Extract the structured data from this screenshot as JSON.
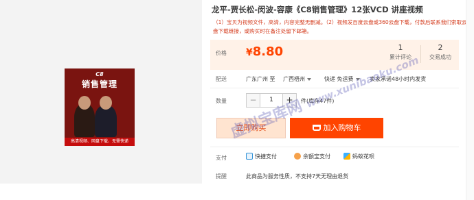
{
  "product": {
    "title": "龙平-贾长松-闵波-容康《C8销售管理》12张VCD 讲座视频",
    "subtitle": "（1）宝贝为视频文件，高清，内容完整无删减。（2）视频发百度云盘或360云盘下载，付款后联系我们索取云盘下载链接，或购买时在备注处留下邮箱。",
    "cover": {
      "logo": "C8",
      "title": "销售管理",
      "band": "高清视频、网盘下载、无需快递"
    }
  },
  "price": {
    "label": "价格",
    "currency": "¥",
    "value": "8.80"
  },
  "stats": [
    {
      "count": "1",
      "label": "累计评论"
    },
    {
      "count": "2",
      "label": "交易成功"
    }
  ],
  "shipping": {
    "label": "配送",
    "from": "广东广州 至",
    "to": "广西梧州",
    "method": "快递 免运费",
    "note": "卖家承诺48小时内发货"
  },
  "quantity": {
    "label": "数量",
    "value": "1",
    "minus": "−",
    "plus": "+",
    "unit": "件(库存47件)"
  },
  "actions": {
    "buy_now": "立即购买",
    "add_to_cart": "加入购物车"
  },
  "payment": {
    "label": "支付",
    "methods": [
      "快捷支付",
      "余额宝支付",
      "蚂蚁花呗"
    ]
  },
  "notice": {
    "label": "提醒",
    "text": "此商品为服务性质，不支持7天无理由退货"
  },
  "watermark": {
    "text": "虚拟宝库网",
    "url": "www.xunibaoku.com"
  },
  "colors": {
    "accent": "#ff4400",
    "price_bg": "#fff2e8",
    "buy_bg": "#ffe4d0"
  }
}
